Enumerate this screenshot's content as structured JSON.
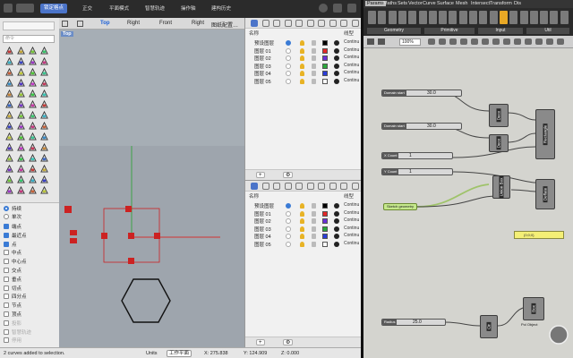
{
  "rhino_top": {
    "active_btn": "锁定格点",
    "items": [
      "正交",
      "平面模式",
      "智慧轨迹",
      "操作轴",
      "建构历史"
    ]
  },
  "viewport": {
    "tabs": [
      "Top",
      "Right",
      "Front",
      "Right",
      "图纸配置…"
    ],
    "label": "Top"
  },
  "command": {
    "placeholder": "命令"
  },
  "osnap": {
    "mode_permanent": "持续",
    "mode_once": "单次",
    "items": [
      {
        "label": "端点",
        "on": true,
        "dim": false
      },
      {
        "label": "最近点",
        "on": true,
        "dim": false
      },
      {
        "label": "点",
        "on": true,
        "dim": false
      },
      {
        "label": "中点",
        "on": false,
        "dim": false
      },
      {
        "label": "中心点",
        "on": false,
        "dim": false
      },
      {
        "label": "交点",
        "on": false,
        "dim": false
      },
      {
        "label": "垂点",
        "on": false,
        "dim": false
      },
      {
        "label": "切点",
        "on": false,
        "dim": false
      },
      {
        "label": "四分点",
        "on": false,
        "dim": false
      },
      {
        "label": "节点",
        "on": false,
        "dim": false
      },
      {
        "label": "顶点",
        "on": false,
        "dim": false
      },
      {
        "label": "投影",
        "on": false,
        "dim": true
      },
      {
        "label": "智慧轨迹",
        "on": false,
        "dim": true
      },
      {
        "label": "停用",
        "on": false,
        "dim": true
      }
    ]
  },
  "layers_a": {
    "col_name": "名称",
    "col_linetype": "线型",
    "rows": [
      {
        "name": "预设图层",
        "current": true,
        "color": "#000000",
        "linetype": "Continu"
      },
      {
        "name": "图层 01",
        "current": false,
        "color": "#e32727",
        "linetype": "Continu"
      },
      {
        "name": "图层 02",
        "current": false,
        "color": "#6a2fd8",
        "linetype": "Continu"
      },
      {
        "name": "图层 03",
        "current": false,
        "color": "#2aa83a",
        "linetype": "Continu"
      },
      {
        "name": "图层 04",
        "current": false,
        "color": "#2a3dd8",
        "linetype": "Continu"
      },
      {
        "name": "图层 05",
        "current": false,
        "color": "#ffffff",
        "linetype": "Continu"
      }
    ]
  },
  "layers_b": {
    "col_name": "名称",
    "col_linetype": "线型",
    "rows": [
      {
        "name": "预设图层",
        "current": true,
        "color": "#000000",
        "linetype": "Continu"
      },
      {
        "name": "图层 01",
        "current": false,
        "color": "#e32727",
        "linetype": "Continu"
      },
      {
        "name": "图层 02",
        "current": false,
        "color": "#6a2fd8",
        "linetype": "Continu"
      },
      {
        "name": "图层 03",
        "current": false,
        "color": "#2aa83a",
        "linetype": "Continu"
      },
      {
        "name": "图层 04",
        "current": false,
        "color": "#2a3dd8",
        "linetype": "Continu"
      },
      {
        "name": "图层 05",
        "current": false,
        "color": "#ffffff",
        "linetype": "Continu"
      }
    ]
  },
  "status": {
    "message": "2 curves added to selection.",
    "units": "Units",
    "plane": "工作平面",
    "x": "X: 275.838",
    "y": "Y: 124.909",
    "z": "Z: 0.000"
  },
  "gh": {
    "tabs": [
      "Params",
      "Maths",
      "Sets",
      "Vector",
      "Curve",
      "Surface",
      "Mesh",
      "Intersect",
      "Transform",
      "Dis"
    ],
    "groups": [
      "Geometry",
      "Primitive",
      "Input",
      "Util"
    ],
    "zoom": "100%",
    "sliders": [
      {
        "label": "Domain start",
        "value": "30.0"
      },
      {
        "label": "Domain start",
        "value": "30.0"
      },
      {
        "label": "X Count",
        "value": "1"
      },
      {
        "label": "Y Count",
        "value": "1"
      },
      {
        "label": "Radius",
        "value": "25.0"
      }
    ],
    "components": [
      "Deco",
      "Rectangle",
      "Deco",
      "Union Box",
      "Deflate",
      "Cir",
      "Box",
      "Pol Object"
    ],
    "panel_text": "{0;0;0}",
    "sketch": "Sketch geometry"
  },
  "colors": {
    "accent": "#4b74c9",
    "gh_wire": "#9fc36a",
    "viewport": "#a6aeb5"
  }
}
